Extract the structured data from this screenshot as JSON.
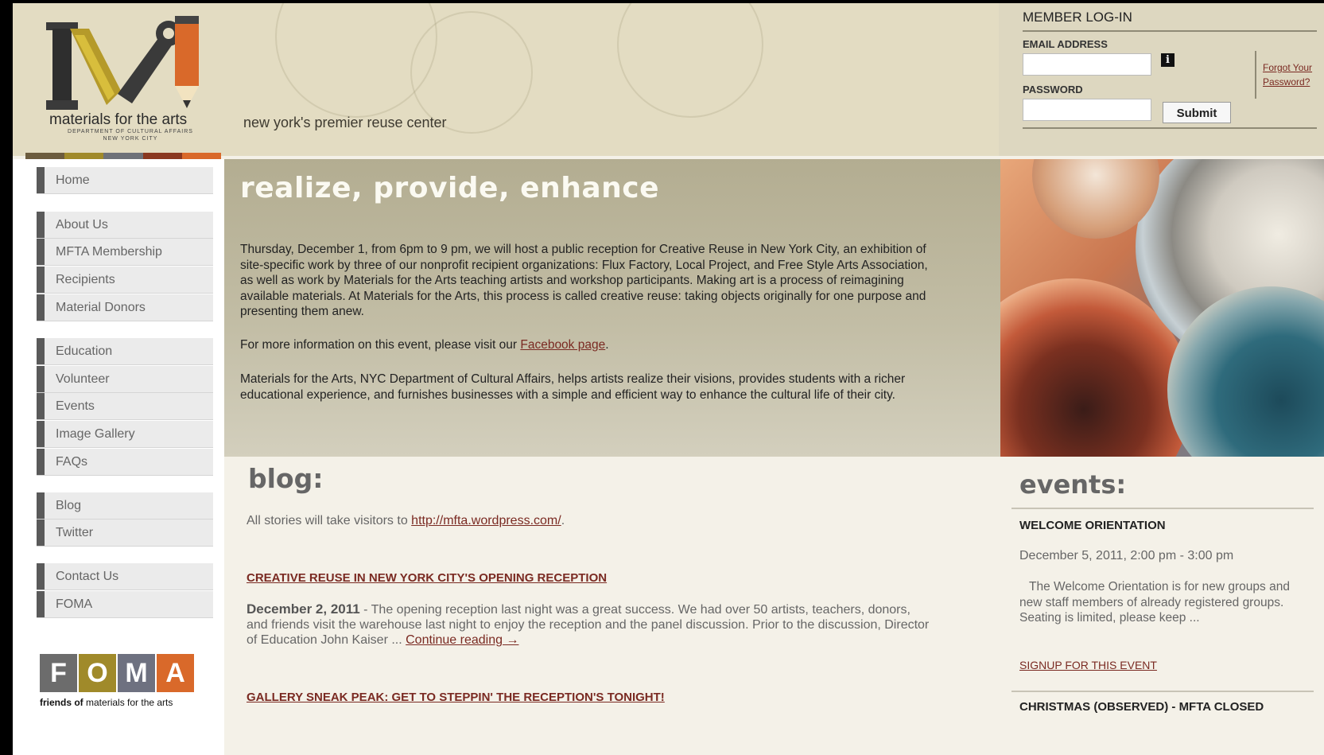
{
  "header": {
    "logo_text": "materials for the arts",
    "logo_dept": "DEPARTMENT OF CULTURAL AFFAIRS NEW YORK CITY",
    "tagline": "new york's premier reuse center",
    "colorbar": [
      "#6c5c3e",
      "#a08a2a",
      "#6e7178",
      "#8a3820",
      "#d9692a"
    ]
  },
  "login": {
    "title": "MEMBER LOG-IN",
    "email_label": "EMAIL ADDRESS",
    "password_label": "PASSWORD",
    "info_icon": "i",
    "forgot_line1": "Forgot Your",
    "forgot_line2": "Password?",
    "submit_label": "Submit"
  },
  "nav": {
    "items": [
      {
        "label": "Home"
      },
      {
        "label": "About Us"
      },
      {
        "label": "MFTA Membership"
      },
      {
        "label": "Recipients"
      },
      {
        "label": "Material Donors"
      },
      {
        "label": "Education"
      },
      {
        "label": "Volunteer"
      },
      {
        "label": "Events"
      },
      {
        "label": "Image Gallery"
      },
      {
        "label": "FAQs"
      },
      {
        "label": "Blog"
      },
      {
        "label": "Twitter"
      },
      {
        "label": "Contact Us"
      },
      {
        "label": "FOMA"
      }
    ]
  },
  "foma": {
    "letters": [
      "F",
      "O",
      "M",
      "A"
    ],
    "letter_colors": [
      "#6c6c6c",
      "#a08a2a",
      "#6e7180",
      "#d9692a"
    ],
    "sub_bold": "friends of",
    "sub_rest": "materials for the arts"
  },
  "feature": {
    "heading": "realize, provide, enhance",
    "para1": "Thursday, December 1, from 6pm to 9 pm, we will host a public reception for Creative Reuse in New York City, an exhibition of site-specific work by three of our nonprofit recipient organizations: Flux Factory, Local Project, and Free Style Arts Association, as well as work by Materials for the Arts teaching artists and workshop participants. Making art is a process of reimagining available materials. At Materials for the Arts, this process is called creative reuse: taking objects originally for one purpose and presenting them anew.",
    "para2_before": "For more information on this event, please visit our ",
    "para2_link": "Facebook page",
    "para2_after": ".",
    "para3": "Materials for the Arts, NYC Department of Cultural Affairs, helps artists realize their visions, provides students with a richer educational experience, and furnishes businesses with a simple and efficient way to enhance the cultural life of their city."
  },
  "blog": {
    "heading": "blog:",
    "intro_before": "All stories will take visitors to ",
    "intro_link": "http://mfta.wordpress.com/",
    "intro_after": ".",
    "post1_title": "CREATIVE REUSE IN NEW YORK CITY'S OPENING RECEPTION",
    "post1_date": "December 2, 2011",
    "post1_text": " - The opening reception last night was a great success. We had over 50 artists, teachers, donors, and friends visit the warehouse last night to enjoy the reception and the panel discussion. Prior to the discussion, Director of Education John Kaiser ... ",
    "post1_more": "Continue reading →",
    "post2_title": "GALLERY SNEAK PEAK: GET TO STEPPIN' THE RECEPTION'S TONIGHT!"
  },
  "events": {
    "heading": "events:",
    "ev1_title": "WELCOME ORIENTATION",
    "ev1_date": "December 5, 2011, 2:00 pm - 3:00 pm",
    "ev1_desc": "The Welcome Orientation is for new groups and new staff members of already registered groups.  Seating is limited, please keep ...",
    "ev1_signup": "SIGNUP FOR THIS EVENT",
    "ev2_title": "CHRISTMAS (OBSERVED) - MFTA CLOSED"
  }
}
